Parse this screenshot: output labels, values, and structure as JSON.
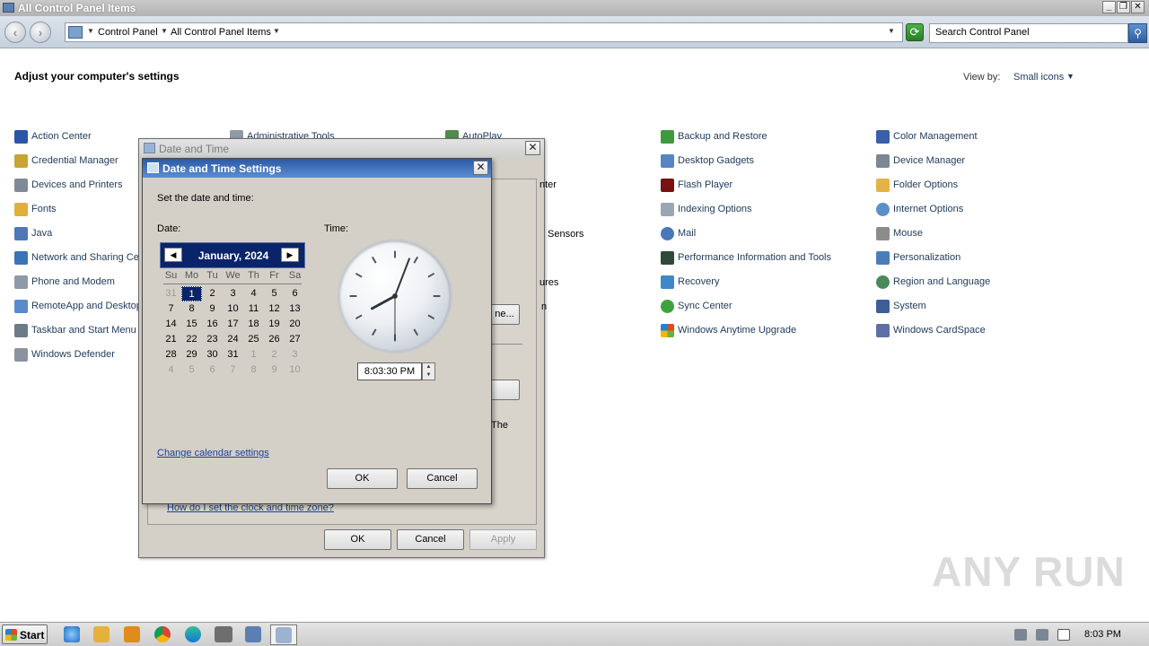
{
  "window": {
    "title": "All Control Panel Items"
  },
  "address": {
    "crumbs": [
      "Control Panel",
      "All Control Panel Items"
    ],
    "search_placeholder": "Search Control Panel"
  },
  "page": {
    "heading": "Adjust your computer's settings",
    "view_by_label": "View by:",
    "view_by_value": "Small icons"
  },
  "items": {
    "col1": [
      "Action Center",
      "Credential Manager",
      "Devices and Printers",
      "Fonts",
      "Java",
      "Network and Sharing Cen",
      "Phone and Modem",
      "RemoteApp and Desktop",
      "Taskbar and Start Menu",
      "Windows Defender"
    ],
    "col2_visible": [
      "Administrative Tools"
    ],
    "col3_visible": [
      "AutoPlay"
    ],
    "col4": [
      "Backup and Restore",
      "Desktop Gadgets",
      "Flash Player",
      "Indexing Options",
      "Mail",
      "Performance Information and Tools",
      "Recovery",
      "Sync Center",
      "Windows Anytime Upgrade"
    ],
    "col5": [
      "Color Management",
      "Device Manager",
      "Folder Options",
      "Internet Options",
      "Mouse",
      "Personalization",
      "Region and Language",
      "System",
      "Windows CardSpace"
    ]
  },
  "outer_dialog": {
    "title": "Date and Time",
    "fragments": [
      "nter",
      "Sensors",
      "ures",
      "n",
      "ne...",
      "The"
    ],
    "help_link": "How do I set the clock and time zone?",
    "ok": "OK",
    "cancel": "Cancel",
    "apply": "Apply"
  },
  "inner_dialog": {
    "title": "Date and Time Settings",
    "instruction": "Set the date and time:",
    "date_label": "Date:",
    "time_label": "Time:",
    "calendar": {
      "month_label": "January, 2024",
      "prev": "◀",
      "next": "▶",
      "weekdays": [
        "Su",
        "Mo",
        "Tu",
        "We",
        "Th",
        "Fr",
        "Sa"
      ],
      "weeks": [
        [
          "31",
          "1",
          "2",
          "3",
          "4",
          "5",
          "6"
        ],
        [
          "7",
          "8",
          "9",
          "10",
          "11",
          "12",
          "13"
        ],
        [
          "14",
          "15",
          "16",
          "17",
          "18",
          "19",
          "20"
        ],
        [
          "21",
          "22",
          "23",
          "24",
          "25",
          "26",
          "27"
        ],
        [
          "28",
          "29",
          "30",
          "31",
          "1",
          "2",
          "3"
        ],
        [
          "4",
          "5",
          "6",
          "7",
          "8",
          "9",
          "10"
        ]
      ],
      "selected_day": "1"
    },
    "time_value": "8:03:30 PM",
    "change_calendar_link": "Change calendar settings",
    "ok": "OK",
    "cancel": "Cancel"
  },
  "clock_hands": {
    "hour": 8,
    "minute": 3,
    "second": 30
  },
  "watermark": "ANY RUN",
  "taskbar": {
    "start_label": "Start",
    "clock": "8:03 PM"
  }
}
